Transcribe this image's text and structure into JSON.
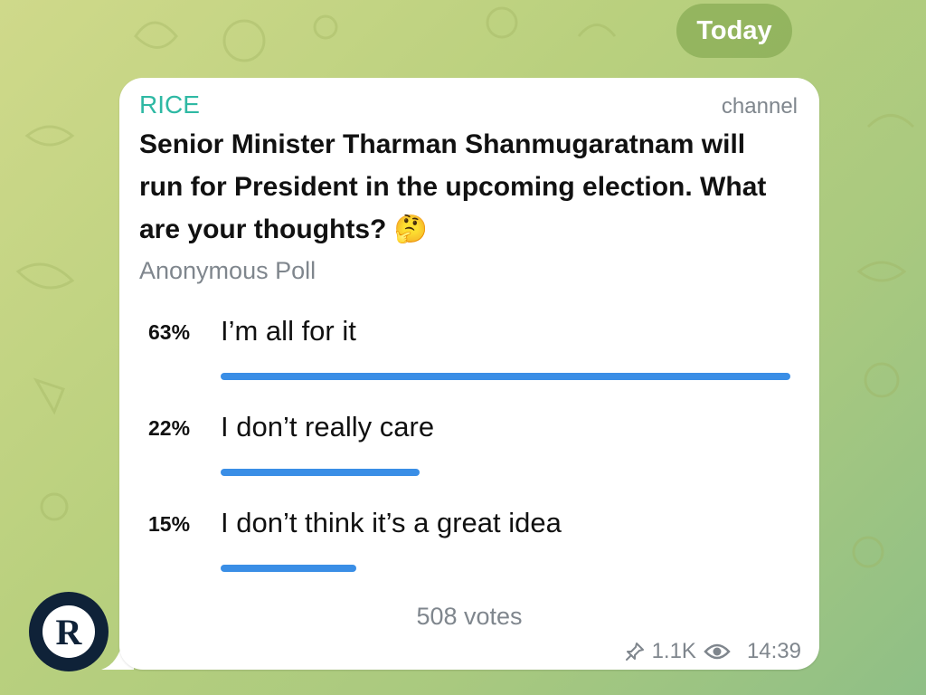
{
  "date_divider": "Today",
  "message": {
    "sender": "RICE",
    "badge": "channel",
    "question": "Senior Minister Tharman Shanmugaratnam will run for President in the upcoming election. What are your thoughts?",
    "question_emoji": "🤔",
    "poll_type": "Anonymous Poll",
    "options": [
      {
        "percent": "63%",
        "label": "I’m all for it",
        "share": 63
      },
      {
        "percent": "22%",
        "label": "I don’t really care",
        "share": 22
      },
      {
        "percent": "15%",
        "label": "I don’t think it’s a great idea",
        "share": 15
      }
    ],
    "votes": "508 votes",
    "views": "1.1K",
    "time": "14:39"
  },
  "avatar": {
    "letter": "R"
  },
  "colors": {
    "sender": "#2fb9a4",
    "bar": "#3a8ee6",
    "avatar_bg": "#0f2238"
  },
  "icons": [
    "pin-icon",
    "eye-icon"
  ]
}
